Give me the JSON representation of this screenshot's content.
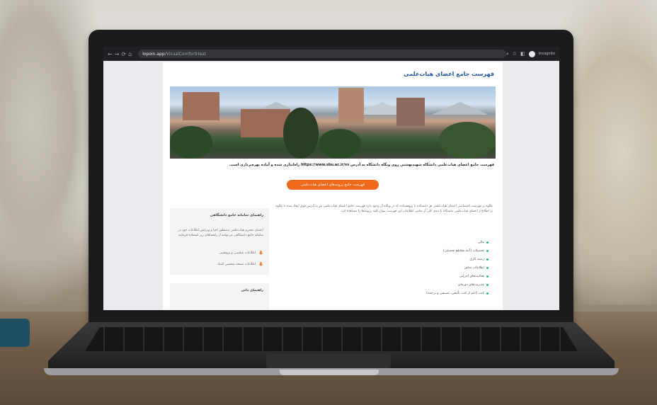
{
  "browser": {
    "url_domain": "lopoin.app",
    "url_path": "/VisualComfortHeat",
    "profile_label": "Incognito",
    "nav_icons": [
      "back-icon",
      "forward-icon",
      "reload-icon",
      "home-icon"
    ]
  },
  "page": {
    "title": "فهرست جامع اعضای هیات‌علمی",
    "intro": "فهرست جامع اعضای هیات‌علمی دانشگاه شهیدبهشتی روی وبگاه دانشگاه به آدرس https://www.sbu.ac.ir/sv راه‌اندازی شده و آماده بهره‌برداری است.",
    "cta_label": "فهرست جامع رزومه‌های اعضای هیات‌علمی",
    "description": "علاوه بر فهرست اختصاصی اعضای هیات‌علمی هر دانشکده یا پژوهشکده که در وبگاه آن وجود دارد فهرست جامع اعضای هیات‌علمی نیز به آدرس فوق ایجاد شده تا علاوه بر اطلاع از اعضای هیات‌علمی دانشگاه با دیدی کلی از تمامی اطلاعات این فهرست بتوان کلیه رزومه‌ها را مشاهده کرد.",
    "list_items": [
      "مالی",
      "تحصیلات (آینه مقاطع تحصیلی)",
      "زمینه کاری",
      "اطلاعات تماس",
      "فعالیت‌های اجرایی",
      "مدیریت‌های دوره‌ای",
      "کتب (اعم از کتب تألیفی، تصنیفی و ترجمه)"
    ]
  },
  "sidebar": {
    "box1_title": "راهنمای سامانه جامع دانشگاهی",
    "box1_text": "اعضای محترم هیات‌علمی به‌منظور احیا و ویرایش اطلاعات خود در سامانه جامع دانشگاهی می‌توانند از راهنماهای زیر استفاده فرمایند.",
    "link1": "اطلاعات شخصی و پژوهشی",
    "link2": "اطلاعات صفحه شخصی استاد",
    "box2_title": "راهنمای داتی"
  },
  "colors": {
    "accent": "#f06a1c",
    "title_blue": "#1f57a8",
    "bullet": "#2bb3a0"
  }
}
